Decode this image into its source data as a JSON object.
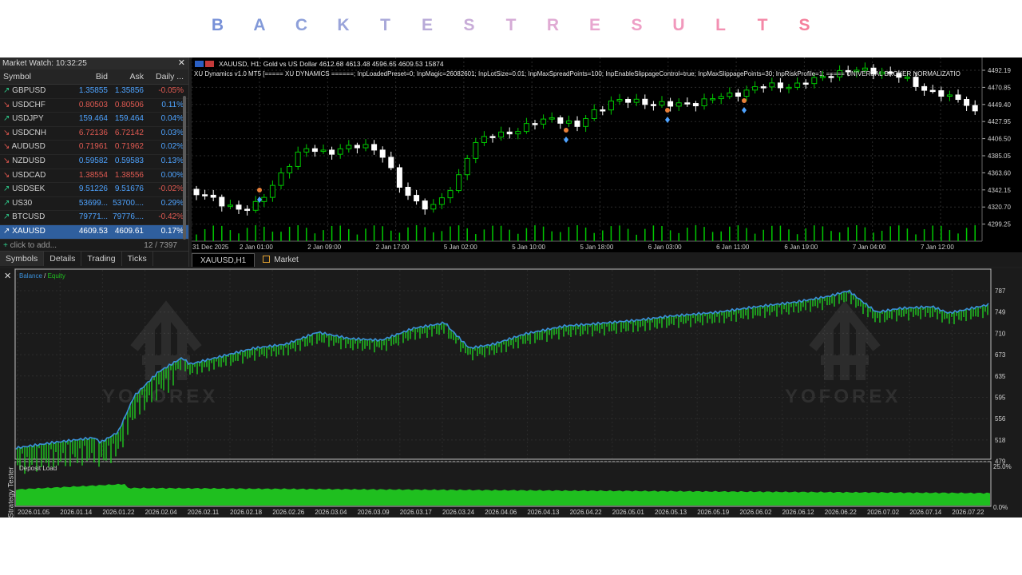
{
  "page_title": {
    "letters": [
      "B",
      "A",
      "C",
      "K",
      "T",
      "E",
      "S",
      "T",
      "R",
      "E",
      "S",
      "U",
      "L",
      "T",
      "S"
    ],
    "colors": [
      "#7891d8",
      "#839ad9",
      "#8ea0da",
      "#9aa4da",
      "#a9a8d9",
      "#b8aad8",
      "#c8acd8",
      "#d5abd6",
      "#e0aad3",
      "#e8a6cf",
      "#ee9fc6",
      "#f198bc",
      "#f390b2",
      "#f488a7",
      "#f5809c"
    ]
  },
  "market_watch": {
    "title": "Market Watch: 10:32:25",
    "columns": [
      "Symbol",
      "Bid",
      "Ask",
      "Daily ..."
    ],
    "rows": [
      {
        "symbol": "GBPUSD",
        "bid": "1.35855",
        "ask": "1.35856",
        "daily": "-0.05%",
        "dir": "up",
        "color": "blue"
      },
      {
        "symbol": "USDCHF",
        "bid": "0.80503",
        "ask": "0.80506",
        "daily": "0.11%",
        "dir": "dn",
        "color": "red"
      },
      {
        "symbol": "USDJPY",
        "bid": "159.464",
        "ask": "159.464",
        "daily": "0.04%",
        "dir": "up",
        "color": "blue"
      },
      {
        "symbol": "USDCNH",
        "bid": "6.72136",
        "ask": "6.72142",
        "daily": "0.03%",
        "dir": "dn",
        "color": "red"
      },
      {
        "symbol": "AUDUSD",
        "bid": "0.71961",
        "ask": "0.71962",
        "daily": "0.02%",
        "dir": "dn",
        "color": "red"
      },
      {
        "symbol": "NZDUSD",
        "bid": "0.59582",
        "ask": "0.59583",
        "daily": "0.13%",
        "dir": "dn",
        "color": "blue"
      },
      {
        "symbol": "USDCAD",
        "bid": "1.38554",
        "ask": "1.38556",
        "daily": "0.00%",
        "dir": "dn",
        "color": "red"
      },
      {
        "symbol": "USDSEK",
        "bid": "9.51226",
        "ask": "9.51676",
        "daily": "-0.02%",
        "dir": "up",
        "color": "blue"
      },
      {
        "symbol": "US30",
        "bid": "53699...",
        "ask": "53700....",
        "daily": "0.29%",
        "dir": "up",
        "color": "blue"
      },
      {
        "symbol": "BTCUSD",
        "bid": "79771...",
        "ask": "79776....",
        "daily": "-0.42%",
        "dir": "up",
        "color": "blue"
      },
      {
        "symbol": "XAUUSD",
        "bid": "4609.53",
        "ask": "4609.61",
        "daily": "0.17%",
        "dir": "up",
        "color": "sel"
      }
    ],
    "add_placeholder": "click to add...",
    "count": "12 / 7397",
    "tabs": [
      "Symbols",
      "Details",
      "Trading",
      "Ticks"
    ]
  },
  "chart": {
    "info": "XAUUSD, H1:  Gold vs US Dollar  4612.68 4613.48 4596.65 4609.53  15874",
    "params": "XU Dynamics v1.0 MT5 [===== XU DYNAMICS ======; InpLoadedPreset=0; InpMagic=26082601; InpLotSize=0.01; InpMaxSpreadPoints=100; InpEnableSlippageControl=true; InpMaxSlippagePoints=30; InpRiskProfile=1; ===== UNIVERSAL BROKER NORMALIZATIO",
    "price_labels": [
      "4492.19",
      "4470.85",
      "4449.40",
      "4427.95",
      "4406.50",
      "4385.05",
      "4363.60",
      "4342.15",
      "4320.70",
      "4299.25"
    ],
    "time_labels": [
      "31 Dec 2025",
      "2 Jan 01:00",
      "2 Jan 09:00",
      "2 Jan 17:00",
      "5 Jan 02:00",
      "5 Jan 10:00",
      "5 Jan 18:00",
      "6 Jan 03:00",
      "6 Jan 11:00",
      "6 Jan 19:00",
      "7 Jan 04:00",
      "7 Jan 12:00"
    ],
    "tabs": [
      "XAUUSD,H1",
      "Market"
    ],
    "colors": {
      "bull": "#00c800",
      "bear": "#ffffff",
      "volume": "#00c800",
      "grid": "#2b2b2b"
    }
  },
  "tester": {
    "side_label": "Strategy Tester",
    "legend_balance": "Balance",
    "legend_sep": " / ",
    "legend_equity": "Equity",
    "y_labels": [
      "787",
      "749",
      "710",
      "673",
      "635",
      "595",
      "556",
      "518",
      "479"
    ],
    "deposit_label": "Deposit Load",
    "deposit_y_labels": [
      "25.0%",
      "0.0%"
    ],
    "x_labels": [
      "2026.01.05",
      "2026.01.14",
      "2026.01.22",
      "2026.02.04",
      "2026.02.11",
      "2026.02.18",
      "2026.02.26",
      "2026.03.04",
      "2026.03.09",
      "2026.03.17",
      "2026.03.24",
      "2026.04.06",
      "2026.04.13",
      "2026.04.22",
      "2026.05.01",
      "2026.05.13",
      "2026.05.19",
      "2026.06.02",
      "2026.06.12",
      "2026.06.22",
      "2026.07.02",
      "2026.07.14",
      "2026.07.22"
    ],
    "watermark_text": "YOFOREX",
    "colors": {
      "balance": "#3a8fd8",
      "equity": "#1fbf1f",
      "deposit": "#1fbf1f"
    }
  }
}
